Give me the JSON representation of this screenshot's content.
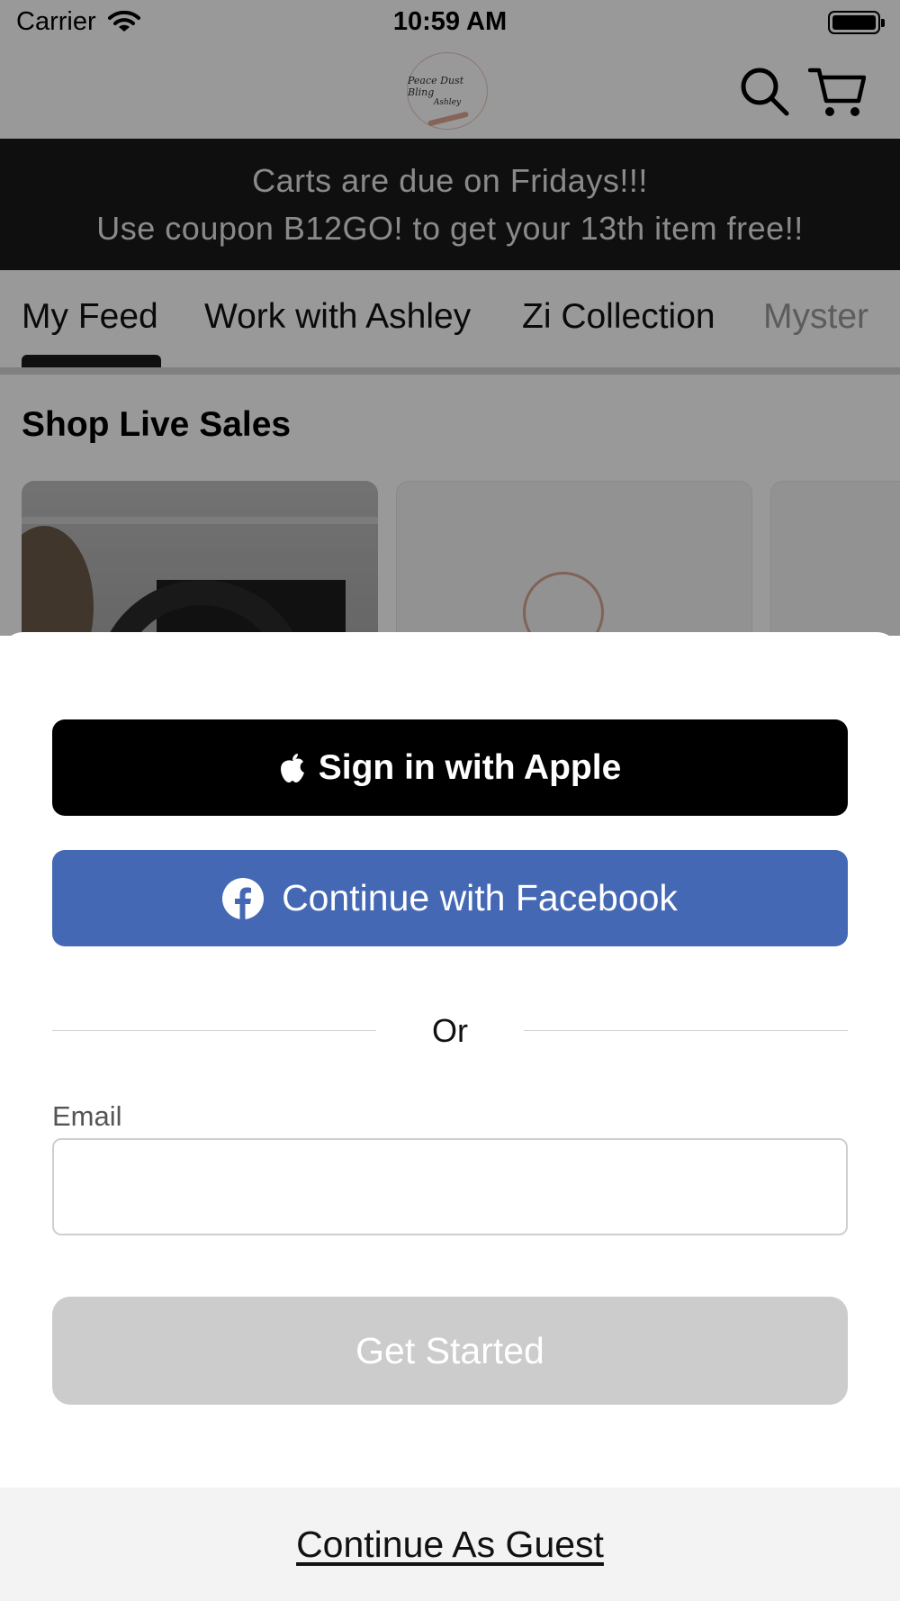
{
  "status_bar": {
    "carrier": "Carrier",
    "time": "10:59 AM"
  },
  "header": {
    "logo_text_line1": "Peace Dust Bling",
    "logo_text_line2": "Ashley",
    "icons": [
      "search-icon",
      "cart-icon"
    ]
  },
  "announcement": {
    "line1": "Carts are due on Fridays!!!",
    "line2": "Use coupon B12GO! to get your 13th item free!!"
  },
  "tabs": {
    "items": [
      {
        "label": "My Feed",
        "selected": true
      },
      {
        "label": "Work with Ashley",
        "selected": false
      },
      {
        "label": "Zi Collection",
        "selected": false
      },
      {
        "label": "Myster",
        "selected": false
      }
    ]
  },
  "feed": {
    "section_title": "Shop Live Sales"
  },
  "login_sheet": {
    "apple_button": "Sign in with Apple",
    "facebook_button": "Continue with Facebook",
    "divider_text": "Or",
    "email_label": "Email",
    "email_value": "",
    "email_placeholder": "",
    "get_started_button": "Get Started",
    "guest_link": "Continue As Guest"
  },
  "colors": {
    "announcement_bg": "#1a1a1a",
    "facebook_blue": "#4468b4",
    "apple_black": "#000000",
    "disabled_button": "#cccccc",
    "guest_bar_bg": "#f3f3f3"
  }
}
